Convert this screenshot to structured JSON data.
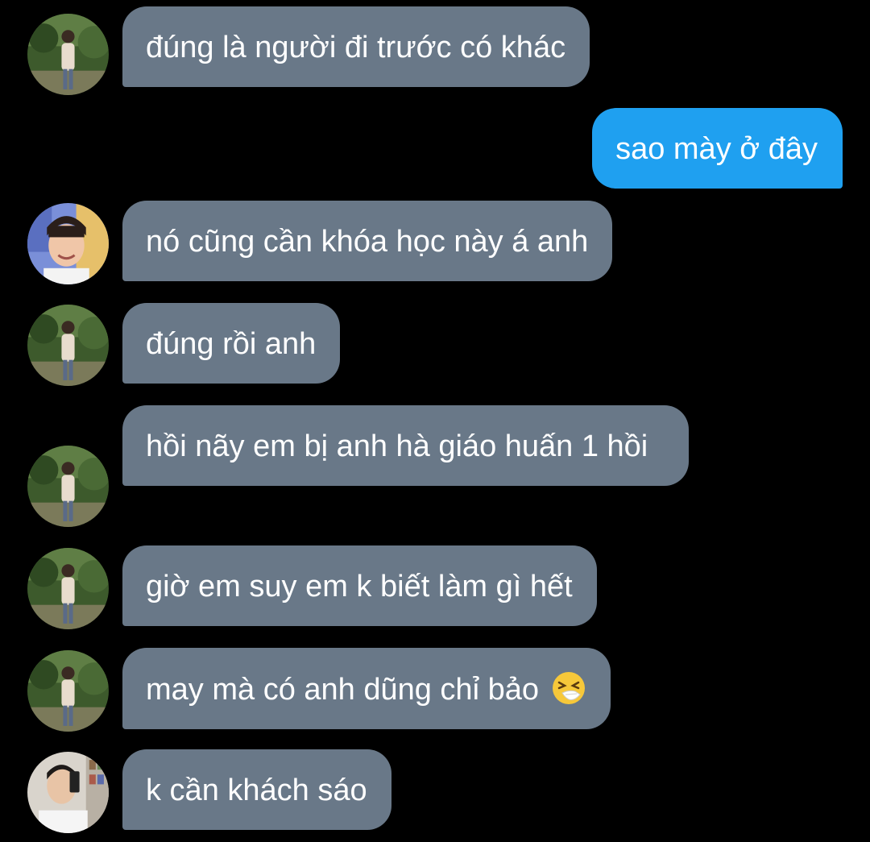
{
  "messages": [
    {
      "sender": "other",
      "avatar": "person-garden",
      "text": "đúng là người đi trước có khác"
    },
    {
      "sender": "me",
      "text": "sao mày ở đây"
    },
    {
      "sender": "other",
      "avatar": "person-smiling",
      "text": "nó cũng cần khóa học này á anh"
    },
    {
      "sender": "other",
      "avatar": "person-garden",
      "text": "đúng rồi anh"
    },
    {
      "sender": "other",
      "avatar": "person-garden",
      "text": "hồi nãy em bị anh hà giáo huấn 1 hồi"
    },
    {
      "sender": "other",
      "avatar": "person-garden",
      "text": "giờ em suy em k biết làm gì hết"
    },
    {
      "sender": "other",
      "avatar": "person-garden",
      "text": "may mà có anh dũng chỉ bảo ",
      "emoji": "sneezing-face-icon"
    },
    {
      "sender": "other",
      "avatar": "person-selfie",
      "text": "k cần khách sáo"
    }
  ],
  "colors": {
    "background": "#000000",
    "incoming_bubble": "#697888",
    "outgoing_bubble": "#1fa0f0",
    "text": "#ffffff"
  }
}
